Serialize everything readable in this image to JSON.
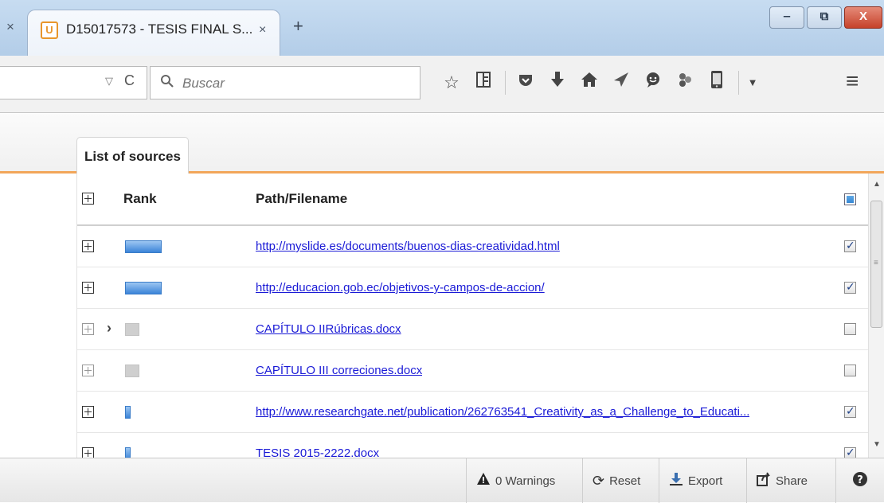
{
  "browser": {
    "tab_title": "D15017573 - TESIS FINAL S...",
    "tab_favicon_glyph": "U",
    "prev_tab_close": "×",
    "tab_close": "×",
    "new_tab": "+",
    "window_buttons": {
      "minimize": "‒",
      "restore": "⧉",
      "close": "X"
    }
  },
  "navbar": {
    "dropmarker": "▽",
    "reload": "C",
    "search_placeholder": "Buscar",
    "toolbar_icons": [
      "bookmark-star-icon",
      "reading-list-icon",
      "pocket-icon",
      "download-icon",
      "home-icon",
      "send-icon",
      "chat-icon",
      "extension-icon",
      "phone-icon"
    ],
    "menu_icon": "hamburger-menu-icon"
  },
  "page": {
    "tab_label": "List of sources",
    "columns": {
      "rank": "Rank",
      "path": "Path/Filename"
    },
    "rows": [
      {
        "path": "http://myslide.es/documents/buenos-dias-creatividad.html",
        "rank_level": "large",
        "rank_color": "blue",
        "checked": true,
        "dim": false,
        "chevron": false
      },
      {
        "path": "http://educacion.gob.ec/objetivos-y-campos-de-accion/",
        "rank_level": "large",
        "rank_color": "blue",
        "checked": true,
        "dim": false,
        "chevron": false
      },
      {
        "path": "CAPÍTULO IIRúbricas.docx",
        "rank_level": "medium",
        "rank_color": "grey",
        "checked": false,
        "dim": true,
        "chevron": true
      },
      {
        "path": "CAPÍTULO III correciones.docx",
        "rank_level": "medium",
        "rank_color": "grey",
        "checked": false,
        "dim": true,
        "chevron": false
      },
      {
        "path": "http://www.researchgate.net/publication/262763541_Creativity_as_a_Challenge_to_Educati...",
        "rank_level": "small",
        "rank_color": "blue",
        "checked": true,
        "dim": false,
        "chevron": false
      },
      {
        "path": "TESIS 2015-2222.docx",
        "rank_level": "small",
        "rank_color": "blue",
        "checked": true,
        "dim": false,
        "chevron": false
      }
    ],
    "chevron_glyph": "›"
  },
  "footer": {
    "warnings": "0 Warnings",
    "reset": "Reset",
    "export": "Export",
    "share": "Share",
    "help": "?"
  },
  "colors": {
    "accent_orange": "#f2a65a",
    "link_blue": "#1a1ad6",
    "rank_blue": "#3b84d8"
  }
}
